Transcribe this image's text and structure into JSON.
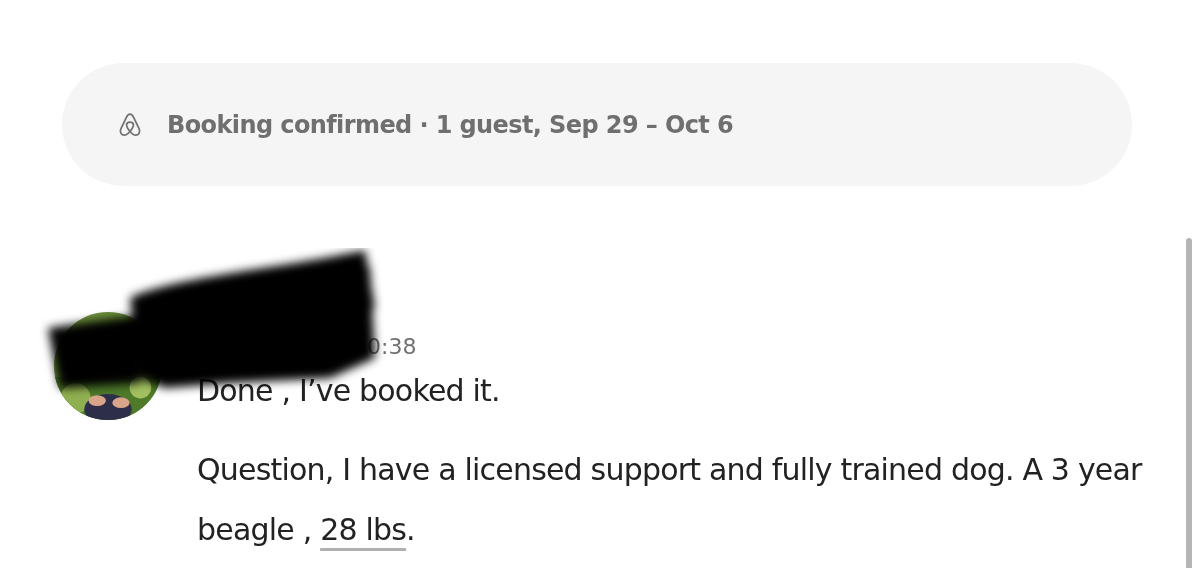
{
  "banner": {
    "text": "**Booking confirmed** · 1 guest, Sep 29 – Oct 6"
  },
  "message": {
    "time": "0:38",
    "paragraphs": [
      {
        "text": "Done , I’ve booked it."
      },
      {
        "text": "Question, I have a licensed support and fully trained dog. A 3 year beagle , ",
        "link": "28 lbs",
        "after": "."
      }
    ]
  }
}
